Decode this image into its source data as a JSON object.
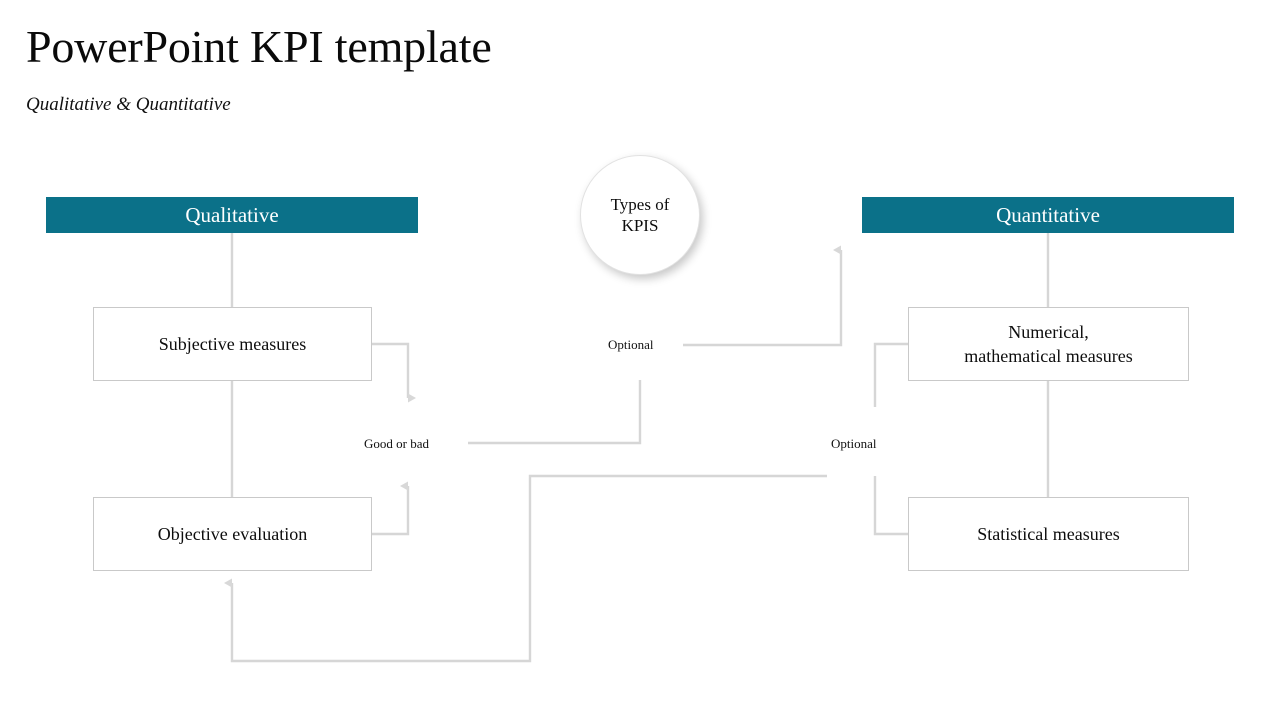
{
  "slide": {
    "title": "PowerPoint KPI template",
    "subtitle": "Qualitative & Quantitative",
    "background_color": "#ffffff"
  },
  "theme": {
    "banner_color": "#0b7189",
    "banner_text_color": "#ffffff",
    "connector_color": "#d4d4d4",
    "box_border_color": "#c9c9c9",
    "text_color": "#101010"
  },
  "center_node": {
    "label_line1": "Types of",
    "label_line2": "KPIS",
    "shape": "circle"
  },
  "columns": [
    {
      "id": "qualitative",
      "banner_label": "Qualitative",
      "nodes": [
        {
          "id": "subjective",
          "label": "Subjective measures"
        },
        {
          "id": "objective",
          "label": "Objective evaluation"
        }
      ]
    },
    {
      "id": "quantitative",
      "banner_label": "Quantitative",
      "nodes": [
        {
          "id": "numerical",
          "label_line1": "Numerical,",
          "label_line2": "mathematical  measures"
        },
        {
          "id": "statistical",
          "label": "Statistical  measures"
        }
      ]
    }
  ],
  "edge_labels": {
    "optional_top": "Optional",
    "good_or_bad": "Good or bad",
    "optional_right": "Optional"
  }
}
